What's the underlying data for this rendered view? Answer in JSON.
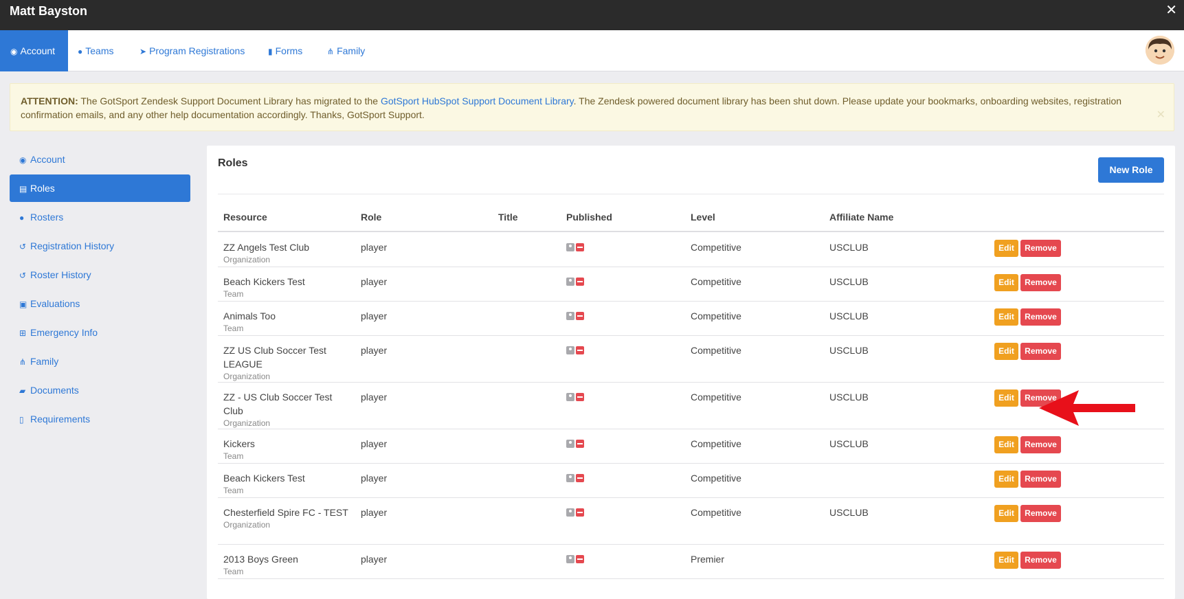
{
  "topbar": {
    "user_name": "Matt Bayston",
    "close_glyph": "✕"
  },
  "nav": {
    "items": [
      {
        "label": "Account",
        "icon": "user-circle-icon",
        "active": true
      },
      {
        "label": "Teams",
        "icon": "users-icon"
      },
      {
        "label": "Program Registrations",
        "icon": "paper-plane-icon"
      },
      {
        "label": "Forms",
        "icon": "file-icon"
      },
      {
        "label": "Family",
        "icon": "sitemap-icon"
      }
    ]
  },
  "alert": {
    "prefix": "ATTENTION:",
    "text_before_link": " The GotSport Zendesk Support Document Library has migrated to the ",
    "link_text": "GotSport HubSpot Support Document Library",
    "text_after_link": ". The Zendesk powered document library has been shut down. Please update your bookmarks, onboarding websites, registration confirmation emails, and any other help documentation accordingly. Thanks, GotSport Support.",
    "close_glyph": "✕"
  },
  "sidebar": {
    "items": [
      {
        "label": "Account",
        "icon": "user-circle-icon",
        "glyph": "◉"
      },
      {
        "label": "Roles",
        "icon": "id-card-icon",
        "glyph": "▤",
        "active": true
      },
      {
        "label": "Rosters",
        "icon": "users-icon",
        "glyph": "●"
      },
      {
        "label": "Registration History",
        "icon": "history-icon",
        "glyph": "↺"
      },
      {
        "label": "Roster History",
        "icon": "history-icon",
        "glyph": "↺"
      },
      {
        "label": "Evaluations",
        "icon": "calendar-check-icon",
        "glyph": "▣"
      },
      {
        "label": "Emergency Info",
        "icon": "plus-square-icon",
        "glyph": "⊞"
      },
      {
        "label": "Family",
        "icon": "sitemap-icon",
        "glyph": "⋔"
      },
      {
        "label": "Documents",
        "icon": "folder-open-icon",
        "glyph": "▰"
      },
      {
        "label": "Requirements",
        "icon": "file-text-icon",
        "glyph": "▯"
      }
    ]
  },
  "panel": {
    "title": "Roles",
    "new_role_label": "New Role",
    "columns": [
      "Resource",
      "Role",
      "Title",
      "Published",
      "Level",
      "Affiliate Name"
    ],
    "edit_label": "Edit",
    "remove_label": "Remove",
    "rows": [
      {
        "resource": "ZZ Angels Test Club",
        "type": "Organization",
        "role": "player",
        "title": "",
        "level": "Competitive",
        "affiliate": "USCLUB"
      },
      {
        "resource": "Beach Kickers Test",
        "type": "Team",
        "role": "player",
        "title": "",
        "level": "Competitive",
        "affiliate": "USCLUB"
      },
      {
        "resource": "Animals Too",
        "type": "Team",
        "role": "player",
        "title": "",
        "level": "Competitive",
        "affiliate": "USCLUB"
      },
      {
        "resource": "ZZ US Club Soccer Test LEAGUE",
        "type": "Organization",
        "role": "player",
        "title": "",
        "level": "Competitive",
        "affiliate": "USCLUB"
      },
      {
        "resource": "ZZ - US Club Soccer Test Club",
        "type": "Organization",
        "role": "player",
        "title": "",
        "level": "Competitive",
        "affiliate": "USCLUB"
      },
      {
        "resource": "Kickers",
        "type": "Team",
        "role": "player",
        "title": "",
        "level": "Competitive",
        "affiliate": "USCLUB"
      },
      {
        "resource": "Beach Kickers Test",
        "type": "Team",
        "role": "player",
        "title": "",
        "level": "Competitive",
        "affiliate": ""
      },
      {
        "resource": "Chesterfield Spire FC - TEST",
        "type": "Organization",
        "role": "player",
        "title": "",
        "level": "Competitive",
        "affiliate": "USCLUB"
      },
      {
        "resource": "2013 Boys Green",
        "type": "Team",
        "role": "player",
        "title": "",
        "level": "Premier",
        "affiliate": ""
      }
    ]
  },
  "colors": {
    "primary": "#2e78d6",
    "edit": "#f0a020",
    "remove": "#e5484f",
    "arrow": "#e8101a"
  }
}
